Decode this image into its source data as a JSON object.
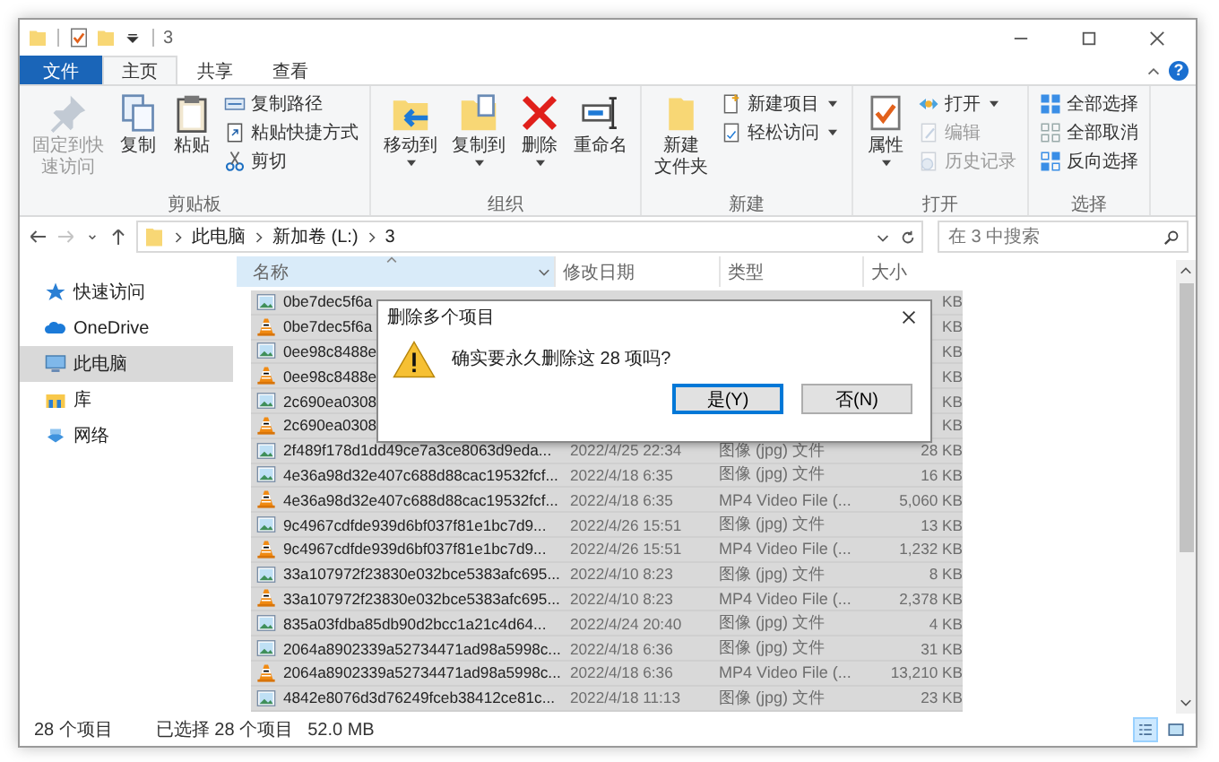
{
  "window": {
    "title": "3",
    "help": "?"
  },
  "ribbon_tabs": [
    {
      "label": "文件",
      "kind": "file",
      "selected": false
    },
    {
      "label": "主页",
      "kind": "tab",
      "selected": true
    },
    {
      "label": "共享",
      "kind": "tab",
      "selected": false
    },
    {
      "label": "查看",
      "kind": "tab",
      "selected": false
    }
  ],
  "ribbon_groups": [
    {
      "label": "剪贴板",
      "items": [
        {
          "kind": "large",
          "lines": [
            "固定到快",
            "速访问"
          ],
          "dropdown": false,
          "disabled": true
        },
        {
          "kind": "large",
          "lines": [
            "复制"
          ],
          "dropdown": false,
          "disabled": false
        },
        {
          "kind": "large",
          "lines": [
            "粘贴"
          ],
          "dropdown": false,
          "disabled": false
        },
        {
          "kind": "small",
          "label": "复制路径",
          "dropdown": false,
          "disabled": false
        },
        {
          "kind": "small",
          "label": "粘贴快捷方式",
          "dropdown": false,
          "disabled": false
        },
        {
          "kind": "small",
          "label": "剪切",
          "dropdown": false,
          "disabled": false
        }
      ]
    },
    {
      "label": "组织",
      "items": [
        {
          "kind": "large",
          "lines": [
            "移动到"
          ],
          "dropdown": true,
          "disabled": false
        },
        {
          "kind": "large",
          "lines": [
            "复制到"
          ],
          "dropdown": true,
          "disabled": false
        },
        {
          "kind": "large",
          "lines": [
            "删除"
          ],
          "dropdown": true,
          "disabled": false
        },
        {
          "kind": "large",
          "lines": [
            "重命名"
          ],
          "dropdown": false,
          "disabled": false
        }
      ]
    },
    {
      "label": "新建",
      "items": [
        {
          "kind": "large",
          "lines": [
            "新建",
            "文件夹"
          ],
          "dropdown": false,
          "disabled": false
        },
        {
          "kind": "small",
          "label": "新建项目",
          "dropdown": true,
          "disabled": false
        },
        {
          "kind": "small",
          "label": "轻松访问",
          "dropdown": true,
          "disabled": false
        }
      ]
    },
    {
      "label": "打开",
      "items": [
        {
          "kind": "large",
          "lines": [
            "属性"
          ],
          "dropdown": true,
          "disabled": false
        },
        {
          "kind": "small",
          "label": "打开",
          "dropdown": true,
          "disabled": false
        },
        {
          "kind": "small",
          "label": "编辑",
          "dropdown": false,
          "disabled": true
        },
        {
          "kind": "small",
          "label": "历史记录",
          "dropdown": false,
          "disabled": true
        }
      ]
    },
    {
      "label": "选择",
      "items": [
        {
          "kind": "small",
          "label": "全部选择",
          "dropdown": false,
          "disabled": false
        },
        {
          "kind": "small",
          "label": "全部取消",
          "dropdown": false,
          "disabled": false
        },
        {
          "kind": "small",
          "label": "反向选择",
          "dropdown": false,
          "disabled": false
        }
      ]
    }
  ],
  "navigation": [
    {
      "kind": "back",
      "disabled": false
    },
    {
      "kind": "forward",
      "disabled": true
    },
    {
      "kind": "recent",
      "disabled": false
    },
    {
      "kind": "up",
      "disabled": false
    }
  ],
  "address": {
    "crumbs": [
      "此电脑",
      "新加卷 (L:)",
      "3"
    ]
  },
  "search": {
    "placeholder": "在 3 中搜索"
  },
  "sidebar": {
    "items": [
      {
        "label": "快速访问",
        "selected": false
      },
      {
        "label": "OneDrive",
        "selected": false
      },
      {
        "label": "此电脑",
        "selected": true
      },
      {
        "label": "库",
        "selected": false
      },
      {
        "label": "网络",
        "selected": false
      }
    ]
  },
  "table": {
    "columns": [
      {
        "label": "名称",
        "sorted": true
      },
      {
        "label": "修改日期",
        "sorted": false
      },
      {
        "label": "类型",
        "sorted": false
      },
      {
        "label": "大小",
        "sorted": false
      }
    ],
    "rows": [
      {
        "kind": "image",
        "name": "0be7dec5f6a",
        "size": "KB",
        "selected": true
      },
      {
        "kind": "video",
        "name": "0be7dec5f6a",
        "size": "KB",
        "selected": true
      },
      {
        "kind": "image",
        "name": "0ee98c8488e",
        "size": "KB",
        "selected": true
      },
      {
        "kind": "video",
        "name": "0ee98c8488e",
        "size": "KB",
        "selected": true
      },
      {
        "kind": "image",
        "name": "2c690ea0308",
        "size": "KB",
        "selected": true
      },
      {
        "kind": "video",
        "name": "2c690ea0308",
        "size": "KB",
        "selected": true
      },
      {
        "kind": "image",
        "name": "2f489f178d1dd49ce7a3ce8063d9eda...",
        "date": "2022/4/25 22:34",
        "type": "图像 (jpg) 文件",
        "size": "28 KB",
        "selected": true
      },
      {
        "kind": "image",
        "name": "4e36a98d32e407c688d88cac19532fcf...",
        "date": "2022/4/18 6:35",
        "type": "图像 (jpg) 文件",
        "size": "16 KB",
        "selected": true
      },
      {
        "kind": "video",
        "name": "4e36a98d32e407c688d88cac19532fcf...",
        "date": "2022/4/18 6:35",
        "type": "MP4 Video File (...",
        "size": "5,060 KB",
        "selected": true
      },
      {
        "kind": "image",
        "name": "9c4967cdfde939d6bf037f81e1bc7d9...",
        "date": "2022/4/26 15:51",
        "type": "图像 (jpg) 文件",
        "size": "13 KB",
        "selected": true
      },
      {
        "kind": "video",
        "name": "9c4967cdfde939d6bf037f81e1bc7d9...",
        "date": "2022/4/26 15:51",
        "type": "MP4 Video File (...",
        "size": "1,232 KB",
        "selected": true
      },
      {
        "kind": "image",
        "name": "33a107972f23830e032bce5383afc695...",
        "date": "2022/4/10 8:23",
        "type": "图像 (jpg) 文件",
        "size": "8 KB",
        "selected": true
      },
      {
        "kind": "video",
        "name": "33a107972f23830e032bce5383afc695...",
        "date": "2022/4/10 8:23",
        "type": "MP4 Video File (...",
        "size": "2,378 KB",
        "selected": true
      },
      {
        "kind": "image",
        "name": "835a03fdba85db90d2bcc1a21c4d64...",
        "date": "2022/4/24 20:40",
        "type": "图像 (jpg) 文件",
        "size": "4 KB",
        "selected": true
      },
      {
        "kind": "image",
        "name": "2064a8902339a52734471ad98a5998c...",
        "date": "2022/4/18 6:36",
        "type": "图像 (jpg) 文件",
        "size": "31 KB",
        "selected": true
      },
      {
        "kind": "video",
        "name": "2064a8902339a52734471ad98a5998c...",
        "date": "2022/4/18 6:36",
        "type": "MP4 Video File (...",
        "size": "13,210 KB",
        "selected": true
      },
      {
        "kind": "image",
        "name": "4842e8076d3d76249fceb38412ce81c...",
        "date": "2022/4/18 11:13",
        "type": "图像 (jpg) 文件",
        "size": "23 KB",
        "selected": true
      }
    ]
  },
  "dialog": {
    "title": "删除多个项目",
    "message": "确实要永久删除这 28 项吗?",
    "buttons": [
      {
        "label": "是(Y)",
        "focused": true
      },
      {
        "label": "否(N)",
        "focused": false
      }
    ]
  },
  "status_bar": {
    "count": "28 个项目",
    "selection": "已选择 28 个项目",
    "size": "52.0 MB",
    "views": [
      {
        "kind": "details",
        "selected": true
      },
      {
        "kind": "large_icons",
        "selected": false
      }
    ]
  }
}
